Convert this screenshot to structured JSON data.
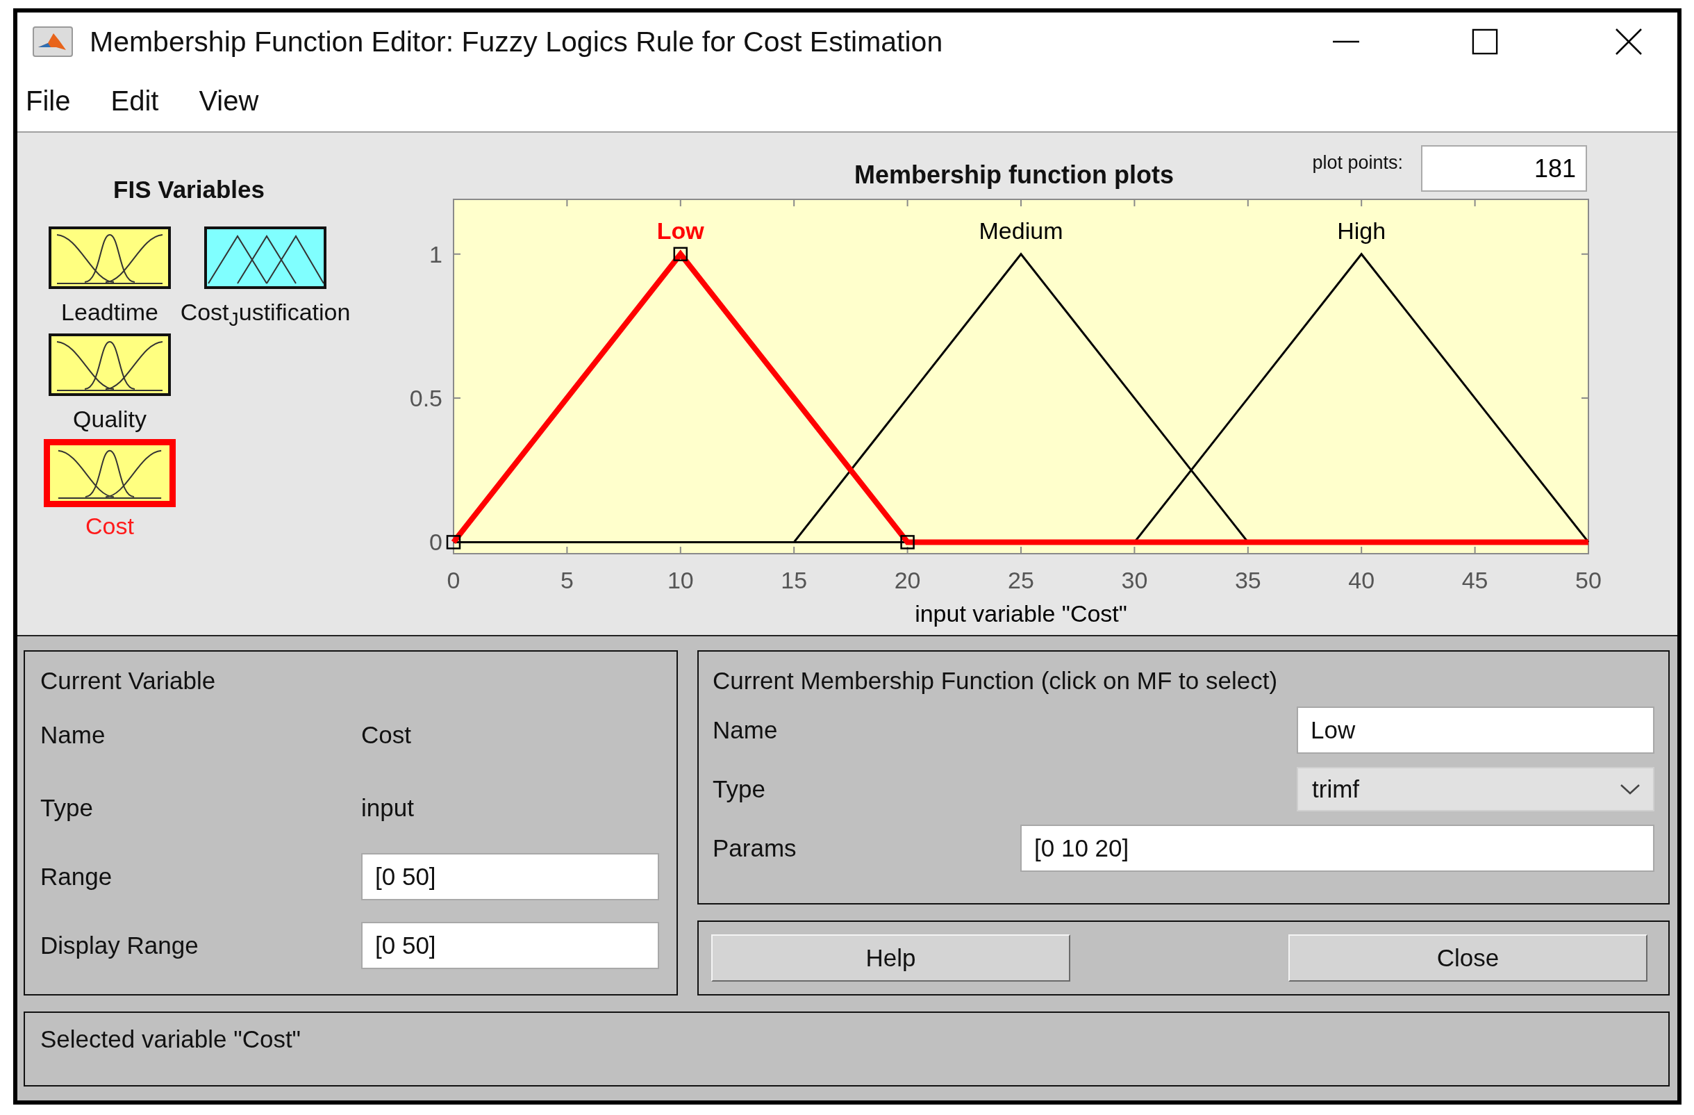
{
  "window": {
    "title": "Membership Function Editor: Fuzzy Logics Rule for Cost Estimation"
  },
  "menu": [
    "File",
    "Edit",
    "View"
  ],
  "fis_variables": {
    "title": "FIS Variables",
    "items": [
      {
        "name": "Leadtime",
        "kind": "input",
        "selected": false
      },
      {
        "name": "Cost$_{J}$ustification",
        "kind": "output",
        "selected": false
      },
      {
        "name": "Quality",
        "kind": "input",
        "selected": false
      },
      {
        "name": "Cost",
        "kind": "input",
        "selected": true
      }
    ]
  },
  "plot": {
    "plot_points_label": "plot points:",
    "plot_points": "181",
    "curves": [
      {
        "selected": true
      },
      {
        "selected": false
      },
      {
        "selected": false
      }
    ],
    "chart_data": {
      "type": "line",
      "title": "Membership function plots",
      "xlabel": "input variable \"Cost\"",
      "x": [
        0,
        5,
        10,
        15,
        20,
        25,
        30,
        35,
        40,
        45,
        50
      ],
      "series": [
        {
          "name": "Low",
          "color": "#ff0000",
          "values": [
            0,
            0.5,
            1,
            0.5,
            0,
            0,
            0,
            0,
            0,
            0,
            0
          ]
        },
        {
          "name": "Medium",
          "color": "#000000",
          "values": [
            0,
            0,
            0,
            0,
            0.5,
            1,
            0.5,
            0,
            0,
            0,
            0
          ]
        },
        {
          "name": "High",
          "color": "#000000",
          "values": [
            0,
            0,
            0,
            0,
            0,
            0,
            0,
            0.5,
            1,
            0.5,
            0
          ]
        }
      ],
      "xlim": [
        0,
        50
      ],
      "ylim": [
        -0.04,
        1.19
      ],
      "xticks": [
        0,
        5,
        10,
        15,
        20,
        25,
        30,
        35,
        40,
        45,
        50
      ],
      "yticks": [
        0,
        0.5,
        1
      ]
    }
  },
  "current_variable": {
    "title": "Current Variable",
    "rows": [
      {
        "label": "Name",
        "value": "Cost",
        "kind": "text"
      },
      {
        "label": "Type",
        "value": "input",
        "kind": "text"
      },
      {
        "label": "Range",
        "value": "[0 50]",
        "kind": "field"
      },
      {
        "label": "Display Range",
        "value": "[0 50]",
        "kind": "field"
      }
    ]
  },
  "current_mf": {
    "title": "Current Membership Function (click on MF to select)",
    "rows": [
      {
        "label": "Name",
        "value": "Low",
        "kind": "field"
      },
      {
        "label": "Type",
        "value": "trimf",
        "kind": "dropdown"
      },
      {
        "label": "Params",
        "value": "[0 10 20]",
        "kind": "field"
      }
    ]
  },
  "buttons": [
    "Help",
    "Close"
  ],
  "status": "Selected variable \"Cost\""
}
